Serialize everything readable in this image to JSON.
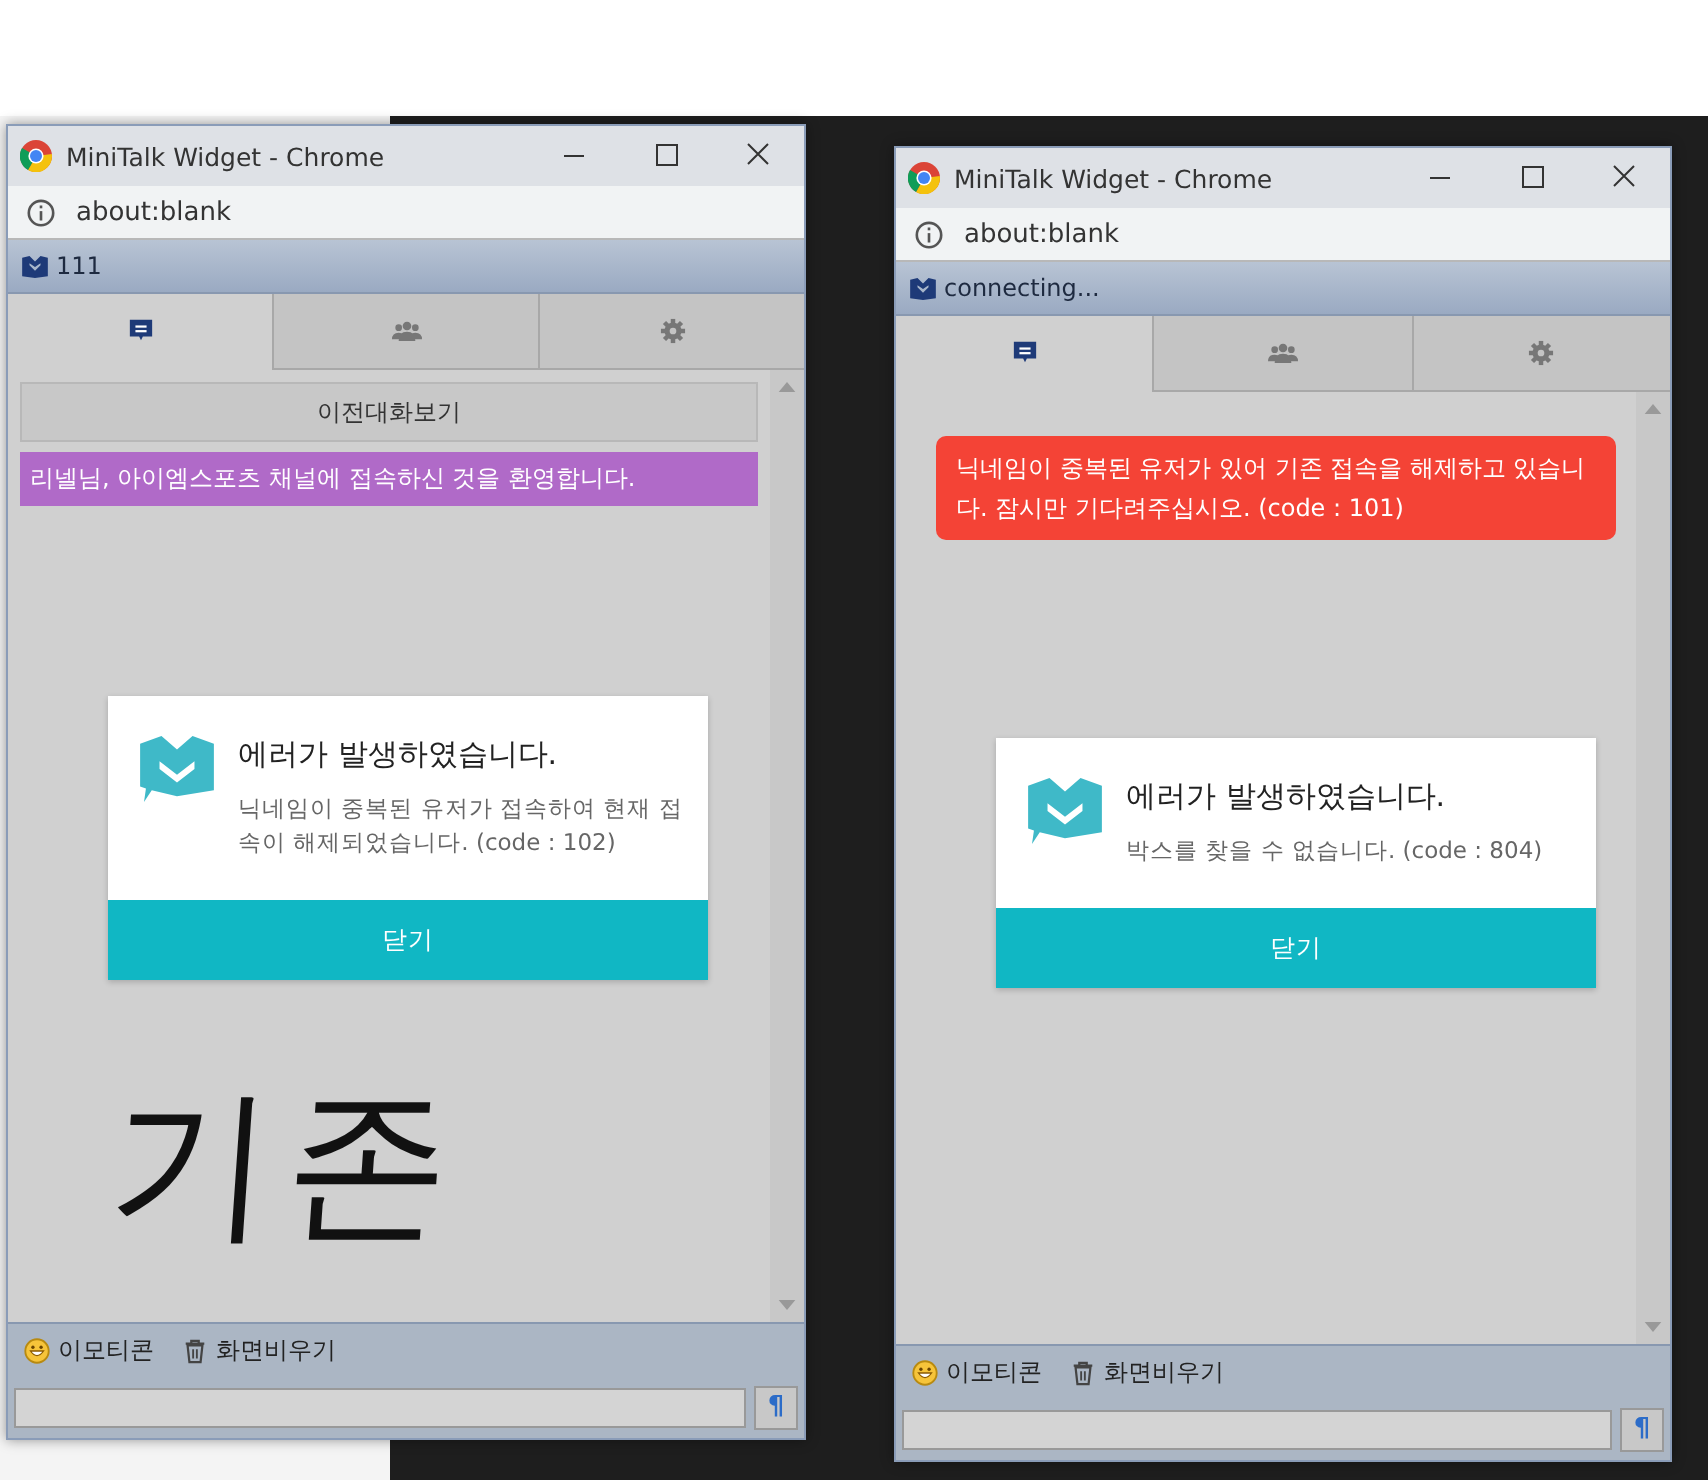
{
  "windows": [
    {
      "title": "MiniTalk Widget - Chrome",
      "address": "about:blank",
      "status": "111",
      "tabs": [
        {
          "selected": true
        },
        {
          "selected": false
        },
        {
          "selected": false
        }
      ],
      "messages": [
        {
          "kind": "history-button",
          "text": "이전대화보기"
        },
        {
          "kind": "notice",
          "text": "리넬님, 아이엠스포츠 채널에 접속하신 것을 환영합니다.",
          "color": "#b06ac8"
        }
      ],
      "dialog": {
        "title": "에러가 발생하였습니다.",
        "message": "닉네임이 중복된 유저가 접속하여 현재 접속이 해제되었습니다. (code : 102)",
        "button": "닫기"
      },
      "annotation": "기존",
      "toolbar": [
        "이모티콘",
        "화면비우기"
      ],
      "send_button": "¶"
    },
    {
      "title": "MiniTalk Widget - Chrome",
      "address": "about:blank",
      "status": "connecting...",
      "tabs": [
        {
          "selected": true
        },
        {
          "selected": false
        },
        {
          "selected": false
        }
      ],
      "messages": [
        {
          "kind": "alert",
          "text": "닉네임이 중복된 유저가 있어 기존 접속을 해제하고 있습니다. 잠시만 기다려주십시오. (code : 101)",
          "color": "#f44336"
        }
      ],
      "dialog": {
        "title": "에러가 발생하였습니다.",
        "message": "박스를 찾을 수 없습니다. (code : 804)",
        "button": "닫기"
      },
      "toolbar": [
        "이모티콘",
        "화면비우기"
      ],
      "send_button": "¶"
    }
  ]
}
